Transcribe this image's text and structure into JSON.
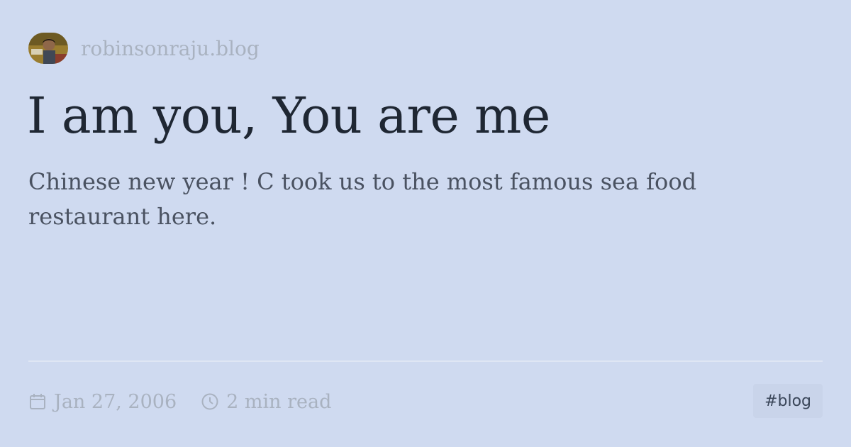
{
  "site": {
    "name": "robinsonraju.blog"
  },
  "post": {
    "title": "I am you, You are me",
    "excerpt": "Chinese new year ! C took us to the most famous sea food restaurant here.",
    "date": "Jan 27, 2006",
    "reading_time": "2 min read",
    "tag": "#blog"
  },
  "icons": {
    "date": "calendar-icon",
    "reading_time": "clock-icon"
  },
  "colors": {
    "background": "#cfdaf0",
    "title": "#1f2733",
    "excerpt": "#4a5261",
    "muted": "#a9b2c0",
    "tag_background": "#c9d4ea",
    "tag_text": "#3a4659"
  }
}
